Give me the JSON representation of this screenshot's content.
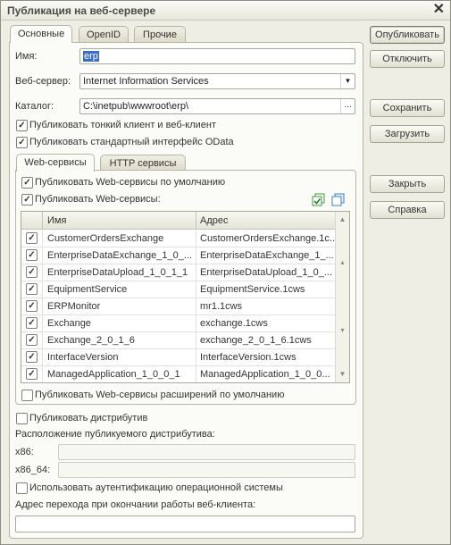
{
  "window": {
    "title": "Публикация на веб-сервере",
    "close_glyph": "✕"
  },
  "tabs": [
    {
      "label": "Основные",
      "active": true
    },
    {
      "label": "OpenID",
      "active": false
    },
    {
      "label": "Прочие",
      "active": false
    }
  ],
  "form": {
    "name_label": "Имя:",
    "name_value": "erp",
    "webserver_label": "Веб-сервер:",
    "webserver_value": "Internet Information Services",
    "catalog_label": "Каталог:",
    "catalog_value": "C:\\inetpub\\wwwroot\\erp\\",
    "catalog_button": "...",
    "publish_thin_client": {
      "label": "Публиковать тонкий клиент и веб-клиент",
      "checked": true
    },
    "publish_odata": {
      "label": "Публиковать стандартный интерфейс OData",
      "checked": true
    }
  },
  "services_tabs": [
    {
      "label": "Web-сервисы",
      "active": true
    },
    {
      "label": "HTTP сервисы",
      "active": false
    }
  ],
  "web_services": {
    "publish_default": {
      "label": "Публиковать Web-сервисы по умолчанию",
      "checked": true
    },
    "publish": {
      "label": "Публиковать Web-сервисы:",
      "checked": true
    },
    "columns": [
      "Имя",
      "Адрес"
    ],
    "rows": [
      {
        "name": "CustomerOrdersExchange",
        "address": "CustomerOrdersExchange.1c...",
        "checked": true
      },
      {
        "name": "EnterpriseDataExchange_1_0_...",
        "address": "EnterpriseDataExchange_1_...",
        "checked": true
      },
      {
        "name": "EnterpriseDataUpload_1_0_1_1",
        "address": "EnterpriseDataUpload_1_0_...",
        "checked": true
      },
      {
        "name": "EquipmentService",
        "address": "EquipmentService.1cws",
        "checked": true
      },
      {
        "name": "ERPMonitor",
        "address": "mr1.1cws",
        "checked": true
      },
      {
        "name": "Exchange",
        "address": "exchange.1cws",
        "checked": true
      },
      {
        "name": "Exchange_2_0_1_6",
        "address": "exchange_2_0_1_6.1cws",
        "checked": true
      },
      {
        "name": "InterfaceVersion",
        "address": "InterfaceVersion.1cws",
        "checked": true
      },
      {
        "name": "ManagedApplication_1_0_0_1",
        "address": "ManagedApplication_1_0_0...",
        "checked": true
      }
    ],
    "publish_extensions": {
      "label": "Публиковать Web-сервисы расширений по умолчанию",
      "checked": false
    }
  },
  "distributive": {
    "publish": {
      "label": "Публиковать дистрибутив",
      "checked": false
    },
    "location_label": "Расположение публикуемого дистрибутива:",
    "x86_label": "x86:",
    "x86_value": "",
    "x86_64_label": "x86_64:",
    "x86_64_value": ""
  },
  "os_auth": {
    "label": "Использовать аутентификацию операционной системы",
    "checked": false
  },
  "exit_url": {
    "label": "Адрес перехода при окончании работы веб-клиента:",
    "value": ""
  },
  "buttons": {
    "publish": "Опубликовать",
    "disable": "Отключить",
    "save": "Сохранить",
    "load": "Загрузить",
    "close": "Закрыть",
    "help": "Справка"
  },
  "colors": {
    "background": "#efeee4",
    "panel": "#fbfbf8",
    "selection": "#3b6fc5",
    "icon_green": "#3f9a3f",
    "icon_blue": "#3a7cc7"
  }
}
